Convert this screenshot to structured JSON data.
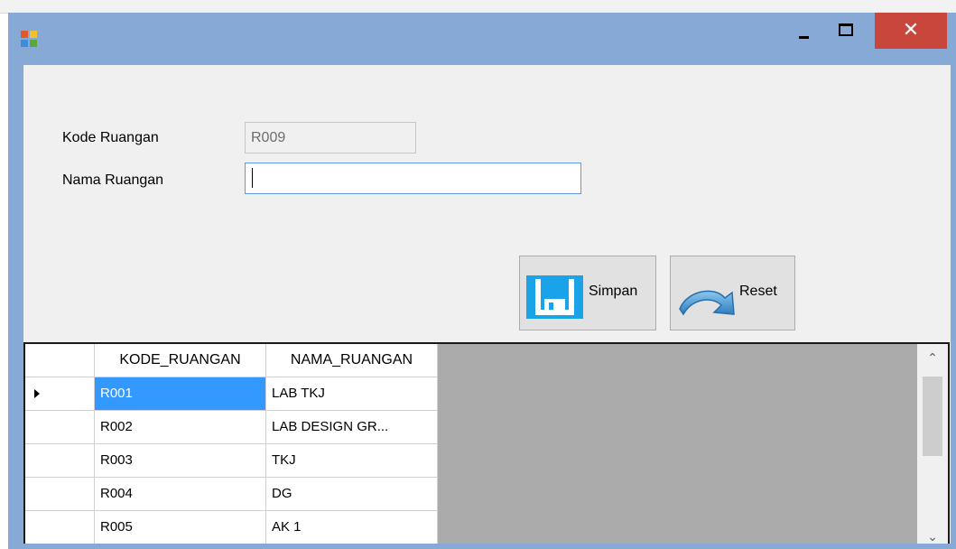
{
  "window": {
    "controls": {
      "close": "✕"
    }
  },
  "form": {
    "kode_label": "Kode Ruangan",
    "kode_value": "R009",
    "nama_label": "Nama Ruangan",
    "nama_value": ""
  },
  "buttons": {
    "simpan": "Simpan",
    "reset": "Reset"
  },
  "grid": {
    "columns": [
      "KODE_RUANGAN",
      "NAMA_RUANGAN"
    ],
    "rows": [
      {
        "kode": "R001",
        "nama": "LAB TKJ"
      },
      {
        "kode": "R002",
        "nama": "LAB DESIGN GR..."
      },
      {
        "kode": "R003",
        "nama": "TKJ"
      },
      {
        "kode": "R004",
        "nama": "DG"
      },
      {
        "kode": "R005",
        "nama": "AK 1"
      }
    ],
    "selected_row": 0
  },
  "colors": {
    "title_bar": "#87a9d6",
    "close_button": "#c9463d",
    "selection": "#3399ff",
    "grid_background": "#ababab"
  },
  "icons": {
    "app": "app-icon",
    "save": "floppy-disk-icon",
    "reset": "undo-arrow-icon"
  }
}
